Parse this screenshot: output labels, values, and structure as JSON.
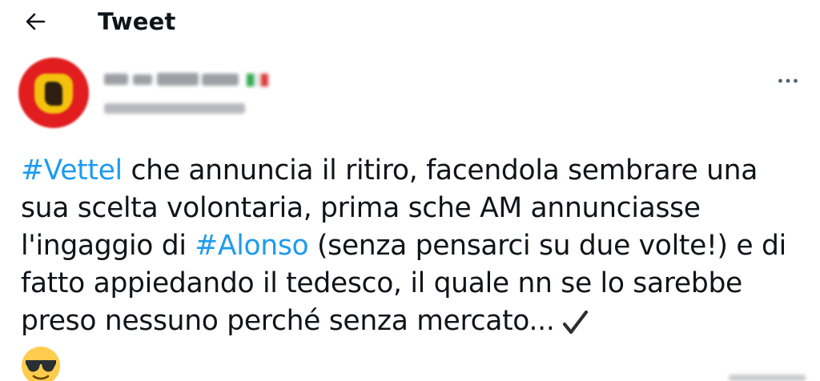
{
  "header": {
    "title": "Tweet"
  },
  "tweet": {
    "segments": [
      {
        "text": "#Vettel",
        "hashtag": true
      },
      {
        "text": " che annuncia il ritiro, facendola sembrare una sua scelta volontaria, prima sche AM annunciasse l'ingaggio di ",
        "hashtag": false
      },
      {
        "text": "#Alonso",
        "hashtag": true
      },
      {
        "text": " (senza pensarci su due volte!) e di fatto appiedando il tedesco, il quale nn se lo sarebbe preso nessuno perché senza mercato...",
        "hashtag": false
      }
    ],
    "end_emoji": "sunglasses-face-emoji"
  },
  "author": {
    "flag": "italy-flag-emoji"
  },
  "colors": {
    "hashtag": "#1d9bf0",
    "text": "#0f1419",
    "avatar_red": "#e11d20",
    "avatar_yellow": "#f4c20d",
    "icon": "#536471"
  },
  "icons": {
    "back": "arrow-left-icon",
    "more": "more-horizontal-icon",
    "check": "heavy-check-mark-icon"
  }
}
